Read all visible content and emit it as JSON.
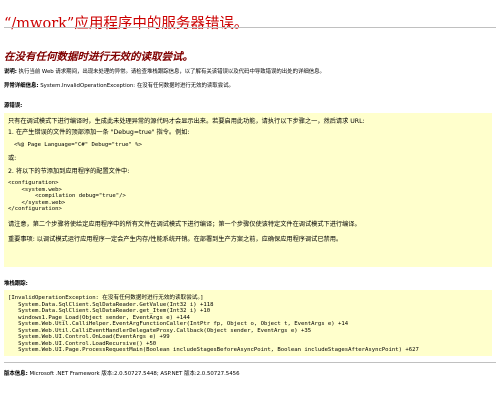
{
  "title": "“/mwork”应用程序中的服务器错误。",
  "subtitle": "在没有任何数据时进行无效的读取尝试。",
  "description": {
    "label": "说明:",
    "text": "执行当前 Web 请求期间，出现未处理的异常。请检查堆栈跟踪信息，以了解有关该错误以及代码中导致错误的出处的详细信息。"
  },
  "exception": {
    "label": "异常详细信息:",
    "text": "System.InvalidOperationException: 在没有任何数据时进行无效的读取尝试。"
  },
  "source_error": {
    "label": "源错误:",
    "lines": [
      "只有在调试模式下进行编译时，生成此未处理异常的源代码才会显示出来。若要启用此功能，请执行以下步骤之一，然后请求 URL:",
      "1. 在产生错误的文件的顶部添加一条 \"Debug=true\" 指令。例如:",
      "或:",
      "2. 将以下的节添加到应用程序的配置文件中:",
      "请注意，第二个步骤将使给定应用程序中的所有文件在调试模式下进行编译；第一个步骤仅使该特定文件在调试模式下进行编译。",
      "重要事项: 以调试模式运行应用程序一定会产生内存/性能系统开销。在部署到生产方案之前，应确保应用程序调试已禁用。"
    ],
    "page_directive": "<%@ Page Language=\"C#\" Debug=\"true\" %>",
    "config_snippet": "<configuration>\n    <system.web>\n        <compilation debug=\"true\"/>\n    </system.web>\n</configuration>"
  },
  "stack_trace": {
    "label": "堆栈跟踪:",
    "text": "[InvalidOperationException: 在没有任何数据时进行无效的读取尝试。]\n   System.Data.SqlClient.SqlDataReader.GetValue(Int32 i) +118\n   System.Data.SqlClient.SqlDataReader.get_Item(Int32 i) +10\n   windows1.Page_Load(Object sender, EventArgs e) +144\n   System.Web.Util.CalliHelper.EventArgFunctionCaller(IntPtr fp, Object o, Object t, EventArgs e) +14\n   System.Web.Util.CalliEventHandlerDelegateProxy.Callback(Object sender, EventArgs e) +35\n   System.Web.UI.Control.OnLoad(EventArgs e) +99\n   System.Web.UI.Control.LoadRecursive() +50\n   System.Web.UI.Page.ProcessRequestMain(Boolean includeStagesBeforeAsyncPoint, Boolean includeStagesAfterAsyncPoint) +627"
  },
  "version": {
    "label": "版本信息:",
    "text": "Microsoft .NET Framework 版本:2.0.50727.5448; ASP.NET 版本:2.0.50727.5456"
  },
  "colors": {
    "title": "#cc0000",
    "subtitle": "#800000",
    "highlight_box": "#ffffcc"
  }
}
